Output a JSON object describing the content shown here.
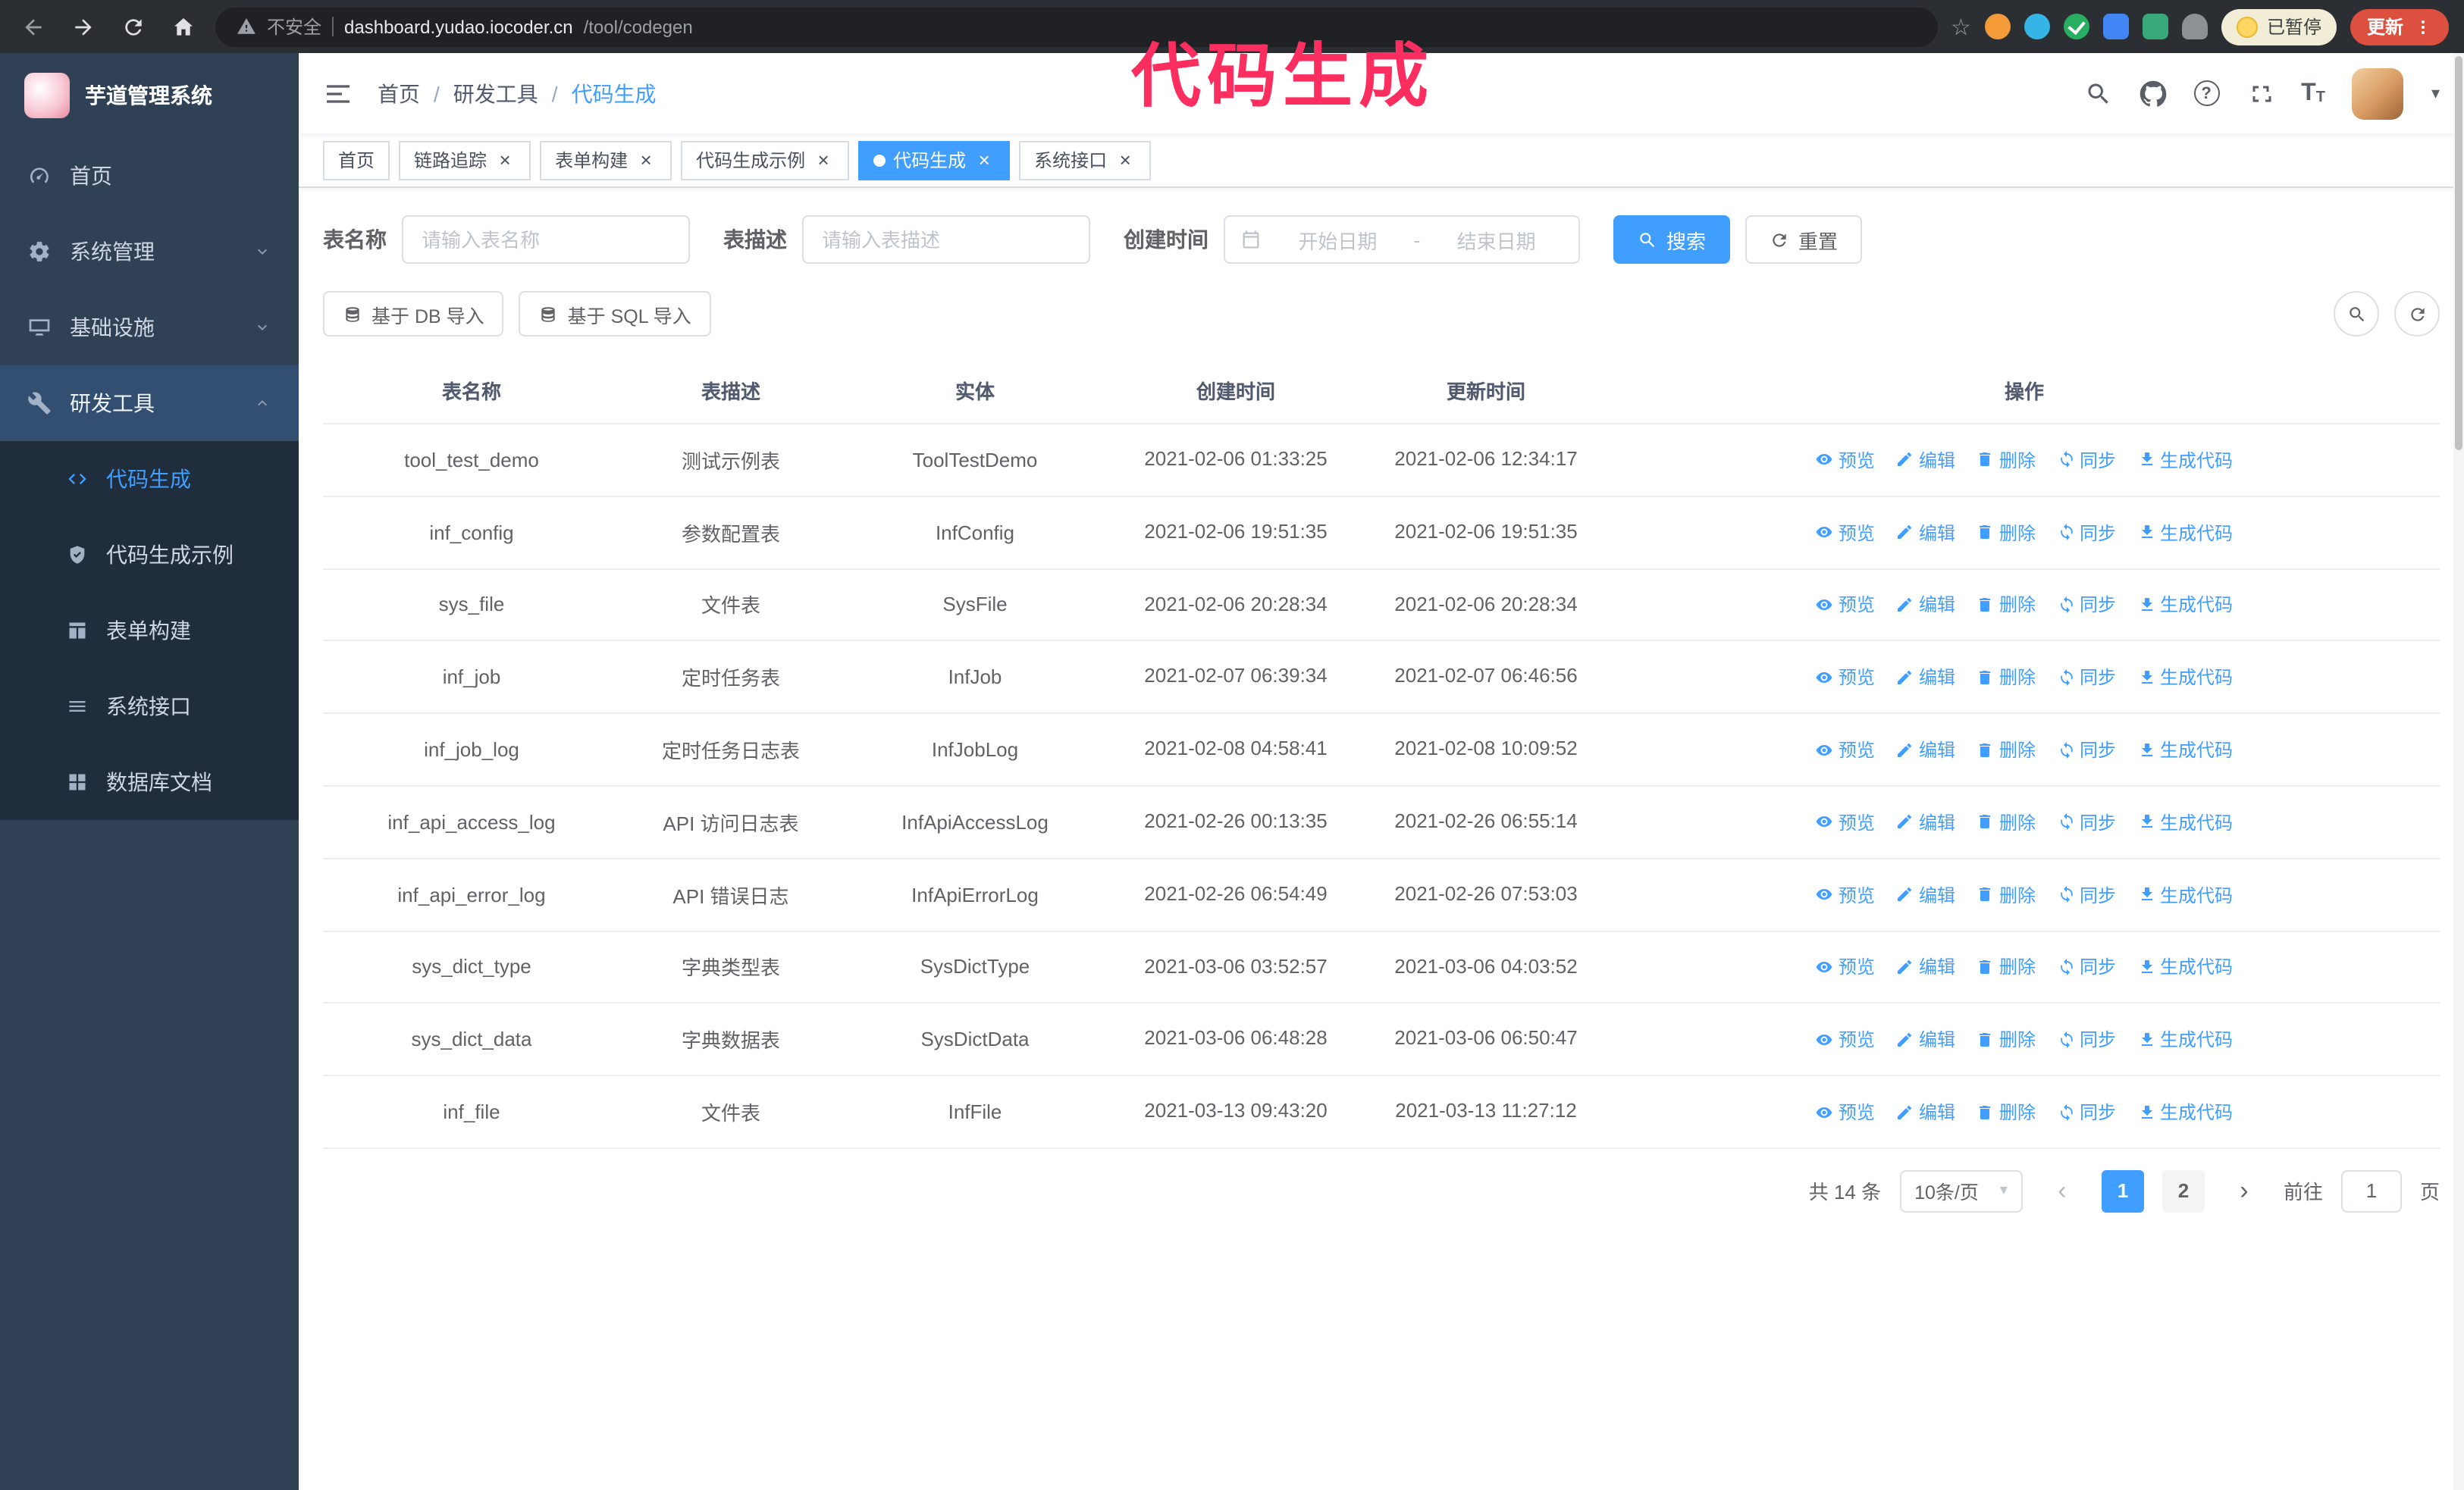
{
  "annotation": {
    "text": "代码生成",
    "color": "#fb2e5f"
  },
  "browser": {
    "insecure_label": "不安全",
    "url_host": "dashboard.yudao.iocoder.cn",
    "url_path": "/tool/codegen",
    "paused_badge": "已暂停",
    "update_button": "更新"
  },
  "icons": {
    "close": "×",
    "caret_down": "▾",
    "prev": "‹",
    "next": "›",
    "question": "?",
    "font_size": "T",
    "star": "☆"
  },
  "colors": {
    "accent": "#409eff",
    "sidebar_bg": "#304156",
    "submenu_bg": "#1f2d3d",
    "annotation": "#fb2e5f",
    "update_button": "#dd4f3e",
    "active_tab_bg": "#409eff"
  },
  "sidebar": {
    "app_title": "芋道管理系统",
    "items": [
      {
        "label": "首页"
      },
      {
        "label": "系统管理"
      },
      {
        "label": "基础设施"
      },
      {
        "label": "研发工具"
      }
    ],
    "submenu": [
      {
        "label": "代码生成"
      },
      {
        "label": "代码生成示例"
      },
      {
        "label": "表单构建"
      },
      {
        "label": "系统接口"
      },
      {
        "label": "数据库文档"
      }
    ]
  },
  "navbar": {
    "breadcrumb": [
      "首页",
      "研发工具",
      "代码生成"
    ],
    "breadcrumb_separator": "/"
  },
  "tabs": [
    {
      "label": "首页",
      "closable": false,
      "active": false
    },
    {
      "label": "链路追踪",
      "closable": true,
      "active": false
    },
    {
      "label": "表单构建",
      "closable": true,
      "active": false
    },
    {
      "label": "代码生成示例",
      "closable": true,
      "active": false
    },
    {
      "label": "代码生成",
      "closable": true,
      "active": true
    },
    {
      "label": "系统接口",
      "closable": true,
      "active": false
    }
  ],
  "filters": {
    "table_name_label": "表名称",
    "table_name_placeholder": "请输入表名称",
    "table_desc_label": "表描述",
    "table_desc_placeholder": "请输入表描述",
    "create_time_label": "创建时间",
    "date_start_placeholder": "开始日期",
    "date_separator": "-",
    "date_end_placeholder": "结束日期",
    "search_button": "搜索",
    "reset_button": "重置"
  },
  "toolbar": {
    "import_db_button": "基于 DB 导入",
    "import_sql_button": "基于 SQL 导入"
  },
  "table": {
    "columns": [
      "表名称",
      "表描述",
      "实体",
      "创建时间",
      "更新时间",
      "操作"
    ],
    "actions": {
      "preview": "预览",
      "edit": "编辑",
      "delete": "删除",
      "sync": "同步",
      "generate": "生成代码"
    },
    "rows": [
      {
        "name": "tool_test_demo",
        "desc": "测试示例表",
        "entity": "ToolTestDemo",
        "create_time": "2021-02-06 01:33:25",
        "update_time": "2021-02-06 12:34:17"
      },
      {
        "name": "inf_config",
        "desc": "参数配置表",
        "entity": "InfConfig",
        "create_time": "2021-02-06 19:51:35",
        "update_time": "2021-02-06 19:51:35"
      },
      {
        "name": "sys_file",
        "desc": "文件表",
        "entity": "SysFile",
        "create_time": "2021-02-06 20:28:34",
        "update_time": "2021-02-06 20:28:34"
      },
      {
        "name": "inf_job",
        "desc": "定时任务表",
        "entity": "InfJob",
        "create_time": "2021-02-07 06:39:34",
        "update_time": "2021-02-07 06:46:56"
      },
      {
        "name": "inf_job_log",
        "desc": "定时任务日志表",
        "entity": "InfJobLog",
        "create_time": "2021-02-08 04:58:41",
        "update_time": "2021-02-08 10:09:52"
      },
      {
        "name": "inf_api_access_log",
        "desc": "API 访问日志表",
        "entity": "InfApiAccessLog",
        "create_time": "2021-02-26 00:13:35",
        "update_time": "2021-02-26 06:55:14"
      },
      {
        "name": "inf_api_error_log",
        "desc": "API 错误日志",
        "entity": "InfApiErrorLog",
        "create_time": "2021-02-26 06:54:49",
        "update_time": "2021-02-26 07:53:03"
      },
      {
        "name": "sys_dict_type",
        "desc": "字典类型表",
        "entity": "SysDictType",
        "create_time": "2021-03-06 03:52:57",
        "update_time": "2021-03-06 04:03:52"
      },
      {
        "name": "sys_dict_data",
        "desc": "字典数据表",
        "entity": "SysDictData",
        "create_time": "2021-03-06 06:48:28",
        "update_time": "2021-03-06 06:50:47"
      },
      {
        "name": "inf_file",
        "desc": "文件表",
        "entity": "InfFile",
        "create_time": "2021-03-13 09:43:20",
        "update_time": "2021-03-13 11:27:12"
      }
    ]
  },
  "pagination": {
    "total_label": "共 14 条",
    "page_size": "10条/页",
    "pages": [
      "1",
      "2"
    ],
    "active_page": "1",
    "goto_label": "前往",
    "goto_value": "1",
    "goto_suffix": "页"
  }
}
